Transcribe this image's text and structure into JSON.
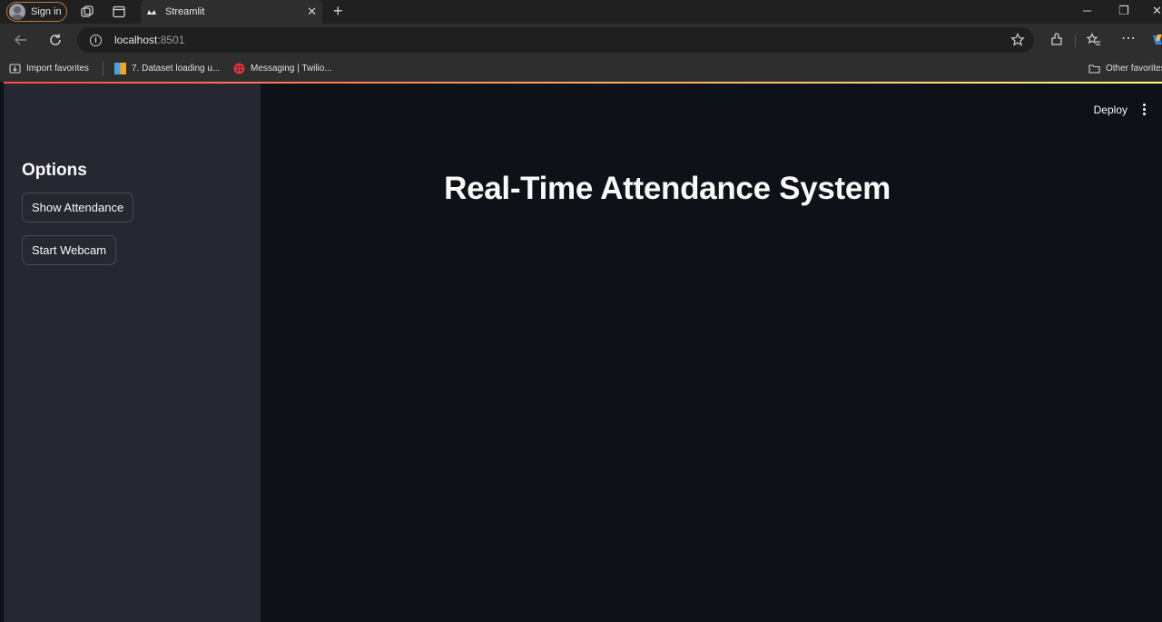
{
  "browser": {
    "sign_in_label": "Sign in",
    "tab_title": "Streamlit",
    "url_host": "localhost",
    "url_port": ":8501",
    "bookmarks": [
      {
        "label": "Import favorites"
      },
      {
        "label": "7. Dataset loading u..."
      },
      {
        "label": "Messaging | Twilio..."
      }
    ],
    "other_favorites_label": "Other favorites"
  },
  "app": {
    "deploy_label": "Deploy",
    "sidebar": {
      "title": "Options",
      "buttons": [
        {
          "label": "Show Attendance"
        },
        {
          "label": "Start Webcam"
        }
      ]
    },
    "main": {
      "title": "Real-Time Attendance System"
    }
  },
  "colors": {
    "app_background": "#0e1117",
    "sidebar_background": "#262730",
    "accent_gradient_start": "#ff4b4b",
    "accent_gradient_end": "#fffd80"
  }
}
